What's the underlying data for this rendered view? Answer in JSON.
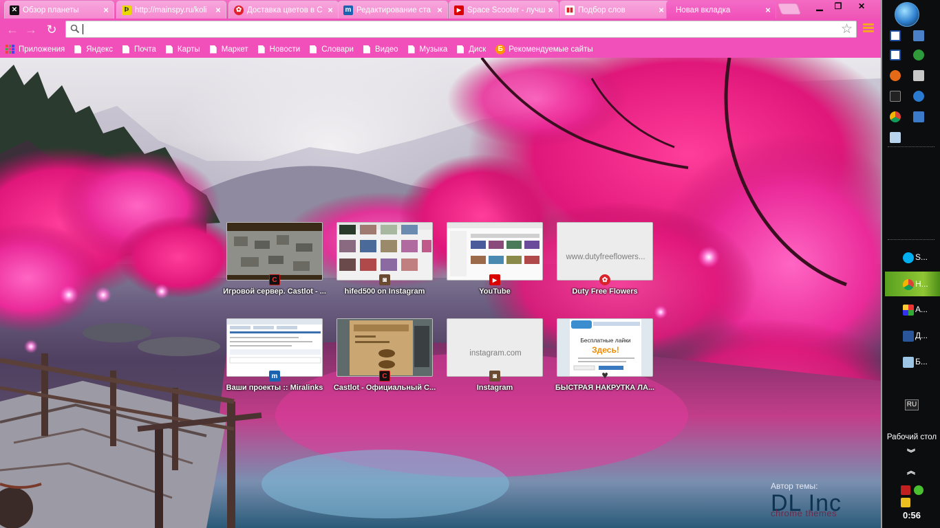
{
  "tabs": [
    {
      "title": "Обзор планеты",
      "icon": "planet-x-icon",
      "color": "#1c1c1c"
    },
    {
      "title": "http://mainspy.ru/koli",
      "icon": "mainspy-icon",
      "color": "#e8d800"
    },
    {
      "title": "Доставка цветов в С",
      "icon": "flower-delivery-icon",
      "color": "#e0202a"
    },
    {
      "title": "Редактирование ста",
      "icon": "miralinks-icon",
      "color": "#1a63b0"
    },
    {
      "title": "Space Scooter - лучш",
      "icon": "youtube-icon",
      "color": "#d90000"
    },
    {
      "title": "Подбор слов",
      "icon": "wordstat-icon",
      "color": "#d8232a"
    },
    {
      "title": "Новая вкладка",
      "icon": "",
      "color": ""
    }
  ],
  "omnibox": {
    "value": "",
    "placeholder": ""
  },
  "bookmarks": [
    {
      "label": "Приложения",
      "type": "apps"
    },
    {
      "label": "Яндекс",
      "type": "page"
    },
    {
      "label": "Почта",
      "type": "page"
    },
    {
      "label": "Карты",
      "type": "page"
    },
    {
      "label": "Маркет",
      "type": "page"
    },
    {
      "label": "Новости",
      "type": "page"
    },
    {
      "label": "Словари",
      "type": "page"
    },
    {
      "label": "Видео",
      "type": "page"
    },
    {
      "label": "Музыка",
      "type": "page"
    },
    {
      "label": "Диск",
      "type": "page"
    },
    {
      "label": "Рекомендуемые сайты",
      "type": "yandex"
    }
  ],
  "tiles": [
    {
      "label": "Игровой сервер. Castlot - ...",
      "thumb": "castlot-game",
      "fav": "C",
      "fav_color": "#c41616",
      "thumb_text": ""
    },
    {
      "label": "hifed500 on Instagram",
      "thumb": "instagram-grid",
      "fav": "◙",
      "fav_color": "#6b4a32",
      "thumb_text": ""
    },
    {
      "label": "YouTube",
      "thumb": "youtube-page",
      "fav": "▶",
      "fav_color": "#d90000",
      "thumb_text": ""
    },
    {
      "label": "Duty Free Flowers",
      "thumb": "blank",
      "fav": "✿",
      "fav_color": "#d8232a",
      "thumb_text": "www.dutyfreeflowers..."
    },
    {
      "label": "Ваши проекты :: Miralinks",
      "thumb": "miralinks-page",
      "fav": "m",
      "fav_color": "#1a63b0",
      "thumb_text": ""
    },
    {
      "label": "Castlot - Официальный С...",
      "thumb": "castlot-site",
      "fav": "C",
      "fav_color": "#c41616",
      "thumb_text": ""
    },
    {
      "label": "Instagram",
      "thumb": "blank",
      "fav": "◙",
      "fav_color": "#6b4a32",
      "thumb_text": "instagram.com"
    },
    {
      "label": "БЫСТРАЯ НАКРУТКА ЛА...",
      "thumb": "likes-page",
      "fav": "♥",
      "fav_color": "#444444",
      "thumb_text": ""
    }
  ],
  "likes_page": {
    "title": "Бесплатные лайки",
    "headline": "Здесь!"
  },
  "credit": {
    "label": "Автор темы:",
    "brand": "DL Inc",
    "sub": "chrome themes"
  },
  "taskbar": {
    "tasks": [
      {
        "label": "S...",
        "icon": "skype-icon",
        "color": "#00aff0",
        "active": false
      },
      {
        "label": "Н...",
        "icon": "chrome-icon",
        "color": "#e4432d",
        "active": true
      },
      {
        "label": "A...",
        "icon": "aimp-icon",
        "color": "#f2a20c",
        "active": false
      },
      {
        "label": "Д...",
        "icon": "word-icon",
        "color": "#2a5699",
        "active": false
      },
      {
        "label": "Б...",
        "icon": "notepad-icon",
        "color": "#7fb3d8",
        "active": false
      }
    ],
    "lang": "RU",
    "desktop_label": "Рабочий стол",
    "clock": "0:56"
  }
}
